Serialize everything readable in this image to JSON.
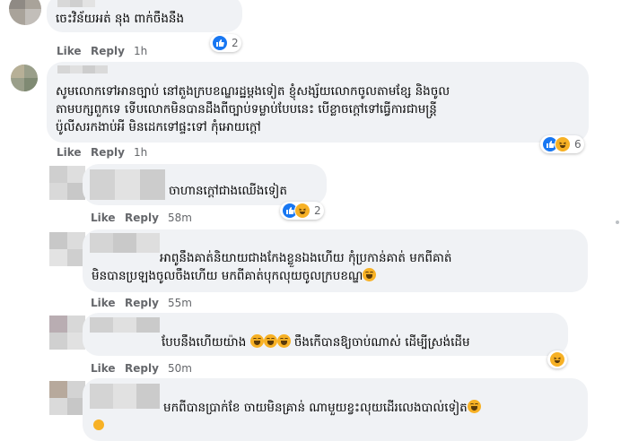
{
  "comments": [
    {
      "text_lines": [
        "ចេះវិន័យអត់ នុង ពាក់ចឹងនឹង"
      ],
      "actions": {
        "like": "Like",
        "reply": "Reply",
        "time": "1h"
      },
      "reactions": {
        "count": "2",
        "icons": [
          "like-icon"
        ]
      }
    },
    {
      "text_lines": [
        "សូមលោកទៅអានច្បាប់ នៅតួងក្របខណ្ឌរដ្ឋម្តងទៀត ខ្ញុំសង្ស័យលោកចូលតាមខ្សែ និងចូល",
        "តាមបក្សពួកទេ ទើបលោកមិនបានដឹងពីច្បាប់ទម្លាប់បែបនេះ បើខ្លាចក្តៅទៅធ្វើការជាមន្ត្រី",
        "ប៉ូលីសរកងាប់អី មិនដេកទៅផ្ទះទៅ កុំអោយក្តៅ"
      ],
      "actions": {
        "like": "Like",
        "reply": "Reply",
        "time": "1h"
      },
      "reactions": {
        "count": "6",
        "icons": [
          "like-icon",
          "haha-icon"
        ]
      }
    }
  ],
  "replies": [
    {
      "text_lines": [
        "ចាហានក្តៅជាងឈើងទៀត"
      ],
      "actions": {
        "like": "Like",
        "reply": "Reply",
        "time": "58m"
      },
      "reactions": {
        "count": "2",
        "icons": [
          "like-icon",
          "haha-icon"
        ]
      }
    },
    {
      "text_lines": [
        "អាពូនឹងគាត់និយាយជាងកែងខ្លួនឯងហើយ កុំប្រកាន់គាត់ មកពីគាត់",
        "មិនបានប្រឡងចូលចឹងហើយ មកពីគាត់បុកលុយចូលក្របខណ្ឌ"
      ],
      "actions": {
        "like": "Like",
        "reply": "Reply",
        "time": "55m"
      }
    },
    {
      "text_lines": [
        "បែបនឹងហើយយ៉ាង",
        "ចឹងកើបានឱ្យចាប់ណាស់ ដើម្បីស្រង់ដើម"
      ],
      "actions": {
        "like": "Like",
        "reply": "Reply",
        "time": "50m"
      }
    },
    {
      "text_lines": [
        "មកពីបានប្រាក់ខែ ចាយមិនគ្រាន់ ណាមួយខ្វះលុយដើរលេងបាល់ទៀត"
      ]
    }
  ],
  "colors": {
    "bubble": "#f0f2f5",
    "meta": "#65676b",
    "like_blue": "#1877f2",
    "haha_yellow": "#f7b125"
  }
}
